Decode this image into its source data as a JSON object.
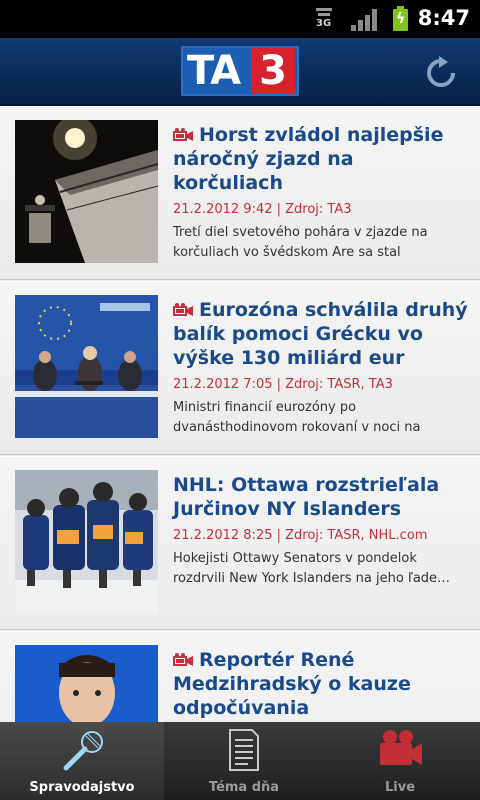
{
  "status_bar": {
    "time": "8:47",
    "network_label": "3G",
    "icons": [
      "3g-data-icon",
      "signal-icon",
      "battery-charging-icon"
    ],
    "battery_color": "#7ec41c"
  },
  "action_bar": {
    "logo_text_ta": "TA",
    "logo_text_3": "3",
    "brand_blue": "#1c5eb2",
    "brand_red": "#d5222c",
    "refresh_icon": "refresh-icon"
  },
  "articles": [
    {
      "title": "Horst zvládol najlepšie náročný zjazd na korčuliach",
      "has_video": true,
      "meta": "21.2.2012 9:42 | Zdroj: TA3",
      "description": "Tretí diel svetového pohára v zjazde na korčuliach vo švédskom Are sa stal koristou…"
    },
    {
      "title": "Eurozóna schválila druhý balík pomoci Grécku vo výške 130 miliárd eur",
      "has_video": true,
      "meta": "21.2.2012 7:05 | Zdroj: TASR, TA3",
      "description": "Ministri financií eurozóny po dvanásthodinovom rokovaní v noci na dnes…"
    },
    {
      "title": "NHL: Ottawa rozstrieľala Jurčinov NY Islanders",
      "has_video": false,
      "meta": "21.2.2012 8:25 | Zdroj: TASR, NHL.com",
      "description": "Hokejisti Ottawy Senators v pondelok rozdrvili New York Islanders na jeho ľade…"
    },
    {
      "title": "Reportér René Medzihradský o kauze odpočúvania",
      "has_video": true,
      "meta": "",
      "description": ""
    }
  ],
  "tabs": [
    {
      "label": "Spravodajstvo",
      "icon": "microphone-icon",
      "active": true
    },
    {
      "label": "Téma dňa",
      "icon": "document-icon",
      "active": false
    },
    {
      "label": "Live",
      "icon": "video-camera-icon",
      "active": false
    }
  ],
  "colors": {
    "title_blue": "#1b4a8a",
    "meta_red": "#c5303a"
  }
}
